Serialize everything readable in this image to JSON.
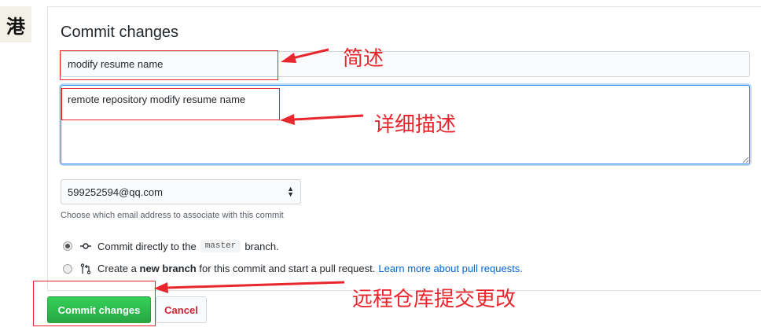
{
  "avatar": {
    "glyph": "港"
  },
  "form": {
    "title": "Commit changes",
    "summary_value": "modify resume name",
    "description_value": "remote repository modify resume name",
    "email_selected": "599252594@qq.com",
    "email_note": "Choose which email address to associate with this commit",
    "option_direct": {
      "prefix": "Commit directly to the",
      "branch": "master",
      "suffix": "branch.",
      "selected": true
    },
    "option_new_branch": {
      "pre": "Create a",
      "bold": "new branch",
      "post": "for this commit and start a pull request.",
      "link": "Learn more about pull requests.",
      "selected": false
    },
    "commit_button": "Commit changes",
    "cancel_button": "Cancel"
  },
  "annotations": {
    "summary_label": "简述",
    "description_label": "详细描述",
    "commit_label": "远程仓库提交更改",
    "color": "#e8262d"
  },
  "icons": [
    "commit-icon",
    "pull-request-icon",
    "select-arrows-icon",
    "resize-grip-icon"
  ],
  "colors": {
    "accent": "#2188ff",
    "commit_green": "#28a745",
    "cancel_red": "#cb2431",
    "link_blue": "#0366d6"
  }
}
